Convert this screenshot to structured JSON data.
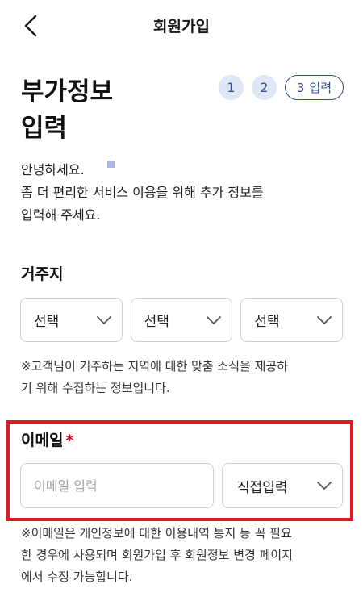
{
  "header": {
    "title": "회원가입",
    "back_icon": "chevron-left-icon"
  },
  "page": {
    "title_line1": "부가정보",
    "title_line2": "입력"
  },
  "steps": {
    "step1": "1",
    "step2": "2",
    "current_number": "3",
    "current_label": "입력"
  },
  "intro": {
    "greeting": "안녕하세요.",
    "line2": "좀 더 편리한 서비스 이용을 위해 추가 정보를",
    "line3": "입력해 주세요."
  },
  "residence": {
    "label": "거주지",
    "selects": [
      "선택",
      "선택",
      "선택"
    ],
    "note_line1": "※고객님이 거주하는 지역에 대한 맞춤 소식을 제공하",
    "note_line2": "기 위해 수집하는 정보입니다."
  },
  "email": {
    "label": "이메일",
    "required_mark": "*",
    "placeholder": "이메일 입력",
    "value": "",
    "domain_select": "직접입력",
    "note_line1": "※이메일은 개인정보에 대한 이용내역 통지 등 꼭 필요",
    "note_line2": "한 경우에 사용되며 회원가입 후 회원정보 변경 페이지",
    "note_line3": "에서 수정 가능합니다."
  },
  "colors": {
    "accent": "#2f4f8f",
    "step_bg": "#dfe6f5",
    "required": "#c8102e",
    "highlight": "#e11b22",
    "border": "#cfcfcf"
  }
}
